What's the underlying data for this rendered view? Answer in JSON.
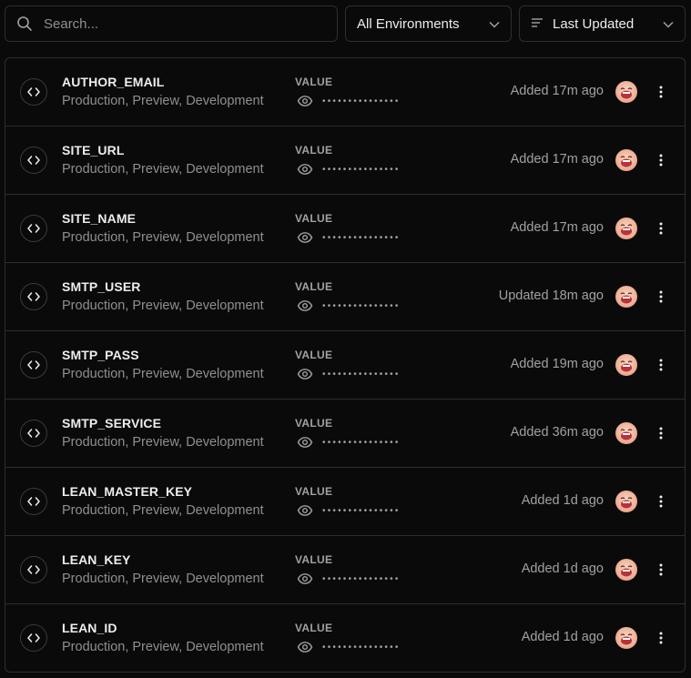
{
  "search": {
    "placeholder": "Search..."
  },
  "environment_filter": {
    "value": "All Environments"
  },
  "sort": {
    "value": "Last Updated"
  },
  "value_label": "VALUE",
  "masked_value": "•••••••••••••••",
  "rows": [
    {
      "key": "AUTHOR_EMAIL",
      "envs": "Production, Preview, Development",
      "meta": "Added 17m ago"
    },
    {
      "key": "SITE_URL",
      "envs": "Production, Preview, Development",
      "meta": "Added 17m ago"
    },
    {
      "key": "SITE_NAME",
      "envs": "Production, Preview, Development",
      "meta": "Added 17m ago"
    },
    {
      "key": "SMTP_USER",
      "envs": "Production, Preview, Development",
      "meta": "Updated 18m ago"
    },
    {
      "key": "SMTP_PASS",
      "envs": "Production, Preview, Development",
      "meta": "Added 19m ago"
    },
    {
      "key": "SMTP_SERVICE",
      "envs": "Production, Preview, Development",
      "meta": "Added 36m ago"
    },
    {
      "key": "LEAN_MASTER_KEY",
      "envs": "Production, Preview, Development",
      "meta": "Added 1d ago"
    },
    {
      "key": "LEAN_KEY",
      "envs": "Production, Preview, Development",
      "meta": "Added 1d ago"
    },
    {
      "key": "LEAN_ID",
      "envs": "Production, Preview, Development",
      "meta": "Added 1d ago"
    }
  ]
}
